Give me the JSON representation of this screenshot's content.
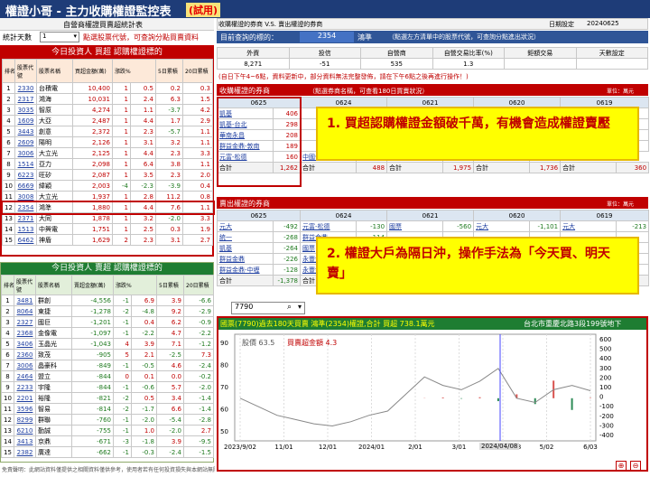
{
  "title": {
    "main": "權證小哥 - 主力收購權證監控表",
    "tag": "(試用)",
    "date_label": "日期設定",
    "date": "20240625"
  },
  "left_header": {
    "title": "自營商權證買賣超統計表",
    "stat_label": "統計天數",
    "days": "1",
    "hint": "點選股票代號，可查詢分點買賣資料"
  },
  "right_header": {
    "title": "收購權證的券商 V.S. 賣出權證的券商",
    "query_label": "目前查詢的標的：",
    "code": "2354",
    "name": "鴻準",
    "hint": "（點選左方清單中的股票代號，可查詢分點進出狀況）"
  },
  "buy_table": {
    "title": "今日投資人 買超 認購權證標的",
    "headers": [
      "排名",
      "股票代號",
      "股票名稱",
      "買超金額(萬)",
      "漲跌%",
      "5日累積",
      "20日累積"
    ],
    "rows": [
      [
        "1",
        "2330",
        "台積電",
        "10,400",
        "1",
        "0.5",
        "0.2",
        "0.3"
      ],
      [
        "2",
        "2317",
        "鴻海",
        "10,031",
        "1",
        "2.4",
        "6.3",
        "1.5"
      ],
      [
        "3",
        "3035",
        "智原",
        "4,274",
        "1",
        "1.1",
        "-3.7",
        "4.2"
      ],
      [
        "4",
        "1609",
        "大亞",
        "2,487",
        "1",
        "4.4",
        "1.7",
        "2.9"
      ],
      [
        "5",
        "3443",
        "創意",
        "2,372",
        "1",
        "2.3",
        "-5.7",
        "1.1"
      ],
      [
        "6",
        "2609",
        "陽明",
        "2,126",
        "1",
        "3.1",
        "3.2",
        "1.1"
      ],
      [
        "7",
        "3006",
        "大立光",
        "2,125",
        "1",
        "4.4",
        "2.3",
        "3.3"
      ],
      [
        "8",
        "1514",
        "亞力",
        "2,098",
        "1",
        "6.4",
        "3.8",
        "1.1"
      ],
      [
        "9",
        "6223",
        "旺矽",
        "2,087",
        "1",
        "3.5",
        "2.3",
        "2.0"
      ],
      [
        "10",
        "6669",
        "緯穎",
        "2,003",
        "-4",
        "-2.3",
        "-3.9",
        "0.4"
      ],
      [
        "11",
        "3008",
        "大立光",
        "1,937",
        "1",
        "2.8",
        "11.2",
        "0.8"
      ],
      [
        "12",
        "2354",
        "鴻準",
        "1,880",
        "1",
        "4.4",
        "7.6",
        "1.1"
      ],
      [
        "13",
        "2371",
        "大同",
        "1,878",
        "1",
        "3.2",
        "-2.0",
        "3.3"
      ],
      [
        "14",
        "1513",
        "中興電",
        "1,751",
        "1",
        "2.5",
        "0.3",
        "1.9"
      ],
      [
        "15",
        "6462",
        "神盾",
        "1,629",
        "2",
        "2.3",
        "3.1",
        "2.7"
      ]
    ]
  },
  "sell_table": {
    "title": "今日投資人 賣超 認購權證標的",
    "headers": [
      "排名",
      "股票代號",
      "股票名稱",
      "賣超金額(萬)",
      "漲跌%",
      "5日累積",
      "20日累積"
    ],
    "rows": [
      [
        "1",
        "3481",
        "群創",
        "-4,556",
        "-1",
        "6.9",
        "3.9",
        "-6.6"
      ],
      [
        "2",
        "8064",
        "東捷",
        "-1,278",
        "-2",
        "-4.8",
        "9.2",
        "-2.9"
      ],
      [
        "3",
        "2327",
        "國巨",
        "-1,201",
        "-1",
        "0.4",
        "6.2",
        "-0.9"
      ],
      [
        "4",
        "2368",
        "金像電",
        "-1,097",
        "-1",
        "-2.2",
        "4.7",
        "-2.2"
      ],
      [
        "5",
        "3406",
        "玉晶光",
        "-1,043",
        "4",
        "3.9",
        "7.1",
        "-1.2"
      ],
      [
        "6",
        "2360",
        "致茂",
        "-905",
        "5",
        "2.1",
        "-2.5",
        "7.3"
      ],
      [
        "7",
        "3006",
        "晶豪科",
        "-849",
        "-1",
        "-0.5",
        "4.6",
        "-2.4"
      ],
      [
        "8",
        "2464",
        "盟立",
        "-844",
        "0",
        "0.1",
        "0.0",
        "-0.2"
      ],
      [
        "9",
        "2233",
        "宇隆",
        "-844",
        "-1",
        "-0.6",
        "5.7",
        "-2.0"
      ],
      [
        "10",
        "2201",
        "裕隆",
        "-821",
        "-2",
        "0.5",
        "3.4",
        "-1.4"
      ],
      [
        "11",
        "3596",
        "智易",
        "-814",
        "-2",
        "-1.7",
        "6.6",
        "-1.4"
      ],
      [
        "12",
        "8299",
        "群聯",
        "-760",
        "-1",
        "-2.0",
        "-5.4",
        "-2.8"
      ],
      [
        "13",
        "6210",
        "勤誠",
        "-755",
        "-1",
        "1.0",
        "-2.0",
        "2.7"
      ],
      [
        "14",
        "3413",
        "京鼎",
        "-671",
        "-3",
        "-1.8",
        "3.9",
        "-9.5"
      ],
      [
        "15",
        "2382",
        "廣達",
        "-662",
        "-1",
        "-0.3",
        "-2.4",
        "-1.5"
      ]
    ]
  },
  "stats": {
    "headers": [
      "外資",
      "投信",
      "自營商",
      "自營交易比率(%)",
      "鉅額交易",
      "天數設定"
    ],
    "values": [
      "8,271",
      "-51",
      "535",
      "1.3",
      "",
      ""
    ],
    "note": "(自日下午4~6點，資料更新中，部分資料無法完整發佈，請在下午6點之後再進行操作！)"
  },
  "buy_brokers": {
    "label": "收購權證的券商",
    "hint": "（點選券商名稱，可查看180日買賣狀況）",
    "unit": "單位：萬元",
    "dates": [
      "0625",
      "0624",
      "0621",
      "0620",
      "0619"
    ],
    "rows": [
      [
        "凱基",
        "406",
        "",
        "",
        "",
        "",
        "",
        "",
        "",
        ""
      ],
      [
        "凱基-台北",
        "298",
        "",
        "",
        "",
        "",
        "",
        "",
        "",
        ""
      ],
      [
        "華南永昌",
        "208",
        "",
        "",
        "",
        "",
        "",
        "",
        "",
        ""
      ],
      [
        "群益金鼎-敦南",
        "189",
        "",
        "",
        "",
        "",
        "",
        "",
        "",
        ""
      ],
      [
        "元富-松德",
        "160",
        "中國信託",
        "79",
        "元富-松德",
        "79",
        "凱基",
        "360"
      ]
    ],
    "totals": [
      "合計",
      "1,262",
      "合計",
      "488",
      "合計",
      "1,975",
      "合計",
      "1,736",
      "合計",
      "360"
    ]
  },
  "sell_brokers": {
    "label": "賣出權證的券商",
    "unit": "單位：萬元",
    "dates": [
      "0625",
      "0624",
      "0621",
      "0620",
      "0619"
    ],
    "rows": [
      [
        "元大",
        "-492",
        "元富-松德",
        "-130",
        "國票",
        "-560",
        "元大",
        "-1,101",
        "元大",
        "-213"
      ],
      [
        "統一",
        "-268",
        "群益金鼎",
        "-114",
        "",
        "",
        "",
        "",
        "",
        ""
      ],
      [
        "凱基",
        "-264",
        "國票",
        "",
        "",
        "",
        "",
        "",
        "",
        ""
      ],
      [
        "群益金鼎",
        "-226",
        "永豐金",
        "",
        "",
        "",
        "",
        "",
        "",
        ""
      ],
      [
        "群益金鼎-中壢",
        "-128",
        "永豐金",
        "",
        "",
        "",
        "",
        "",
        "",
        ""
      ]
    ],
    "totals": [
      "合計",
      "-1,378",
      "合計",
      "",
      "",
      "",
      "",
      "",
      "",
      ""
    ]
  },
  "callout1": "1. 買超認購權證金額破千萬，有機會造成權證賣壓",
  "callout2": "2.  權證大戶為隔日沖，操作手法為「今天買、明天賣」",
  "search": {
    "value": "7790"
  },
  "chart": {
    "header": "國票(7790)過去180天買賣 鴻準(2354)權證,合計 買超 738.1萬元",
    "address": "台北市重慶北路3段199號地下",
    "legend_price": "股價 63.5",
    "legend_amount": "買賣超金額 4.3",
    "highlight": "2024/04/08"
  },
  "chart_data": {
    "type": "line",
    "x": [
      "2023/9/02",
      "11/01",
      "12/01",
      "2024/01",
      "2/01",
      "3/01",
      "2024/04/08",
      "5/02",
      "6/03"
    ],
    "price_series": {
      "name": "股價",
      "values": [
        60,
        56,
        52,
        50,
        48,
        47,
        49,
        52,
        54,
        62,
        70,
        66,
        64,
        68,
        74,
        60,
        58,
        64,
        66,
        63.5
      ]
    },
    "amount_series": {
      "name": "買賣超金額",
      "values": [
        0,
        0,
        0,
        0,
        0,
        0,
        0,
        0,
        0,
        0,
        2,
        8,
        -5,
        10,
        -30,
        40,
        -60,
        180,
        -120,
        4.3
      ]
    },
    "left_axis": [
      "90",
      "80",
      "70",
      "60",
      "50"
    ],
    "right_axis": [
      "600",
      "500",
      "400",
      "300",
      "200",
      "100",
      "0",
      "-100",
      "-200",
      "-300",
      "-400"
    ]
  },
  "footer": "免責聲明：此網站資料僅提供之相關資料僅供參考，使用者若有任何投資損失與本網站無關..."
}
